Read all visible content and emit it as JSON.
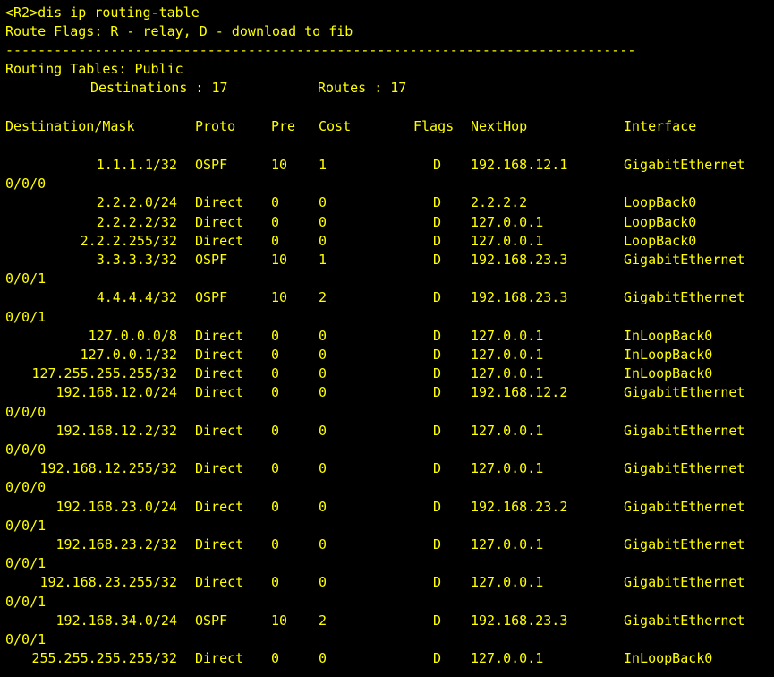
{
  "terminal": {
    "prompt_line": "<R2>dis ip routing-table",
    "flags_legend": "Route Flags: R - relay, D - download to fib",
    "separator": "------------------------------------------------------------------------------",
    "tables_title": "Routing Tables: Public",
    "destinations_label": "Destinations : 17",
    "routes_label": "Routes : 17",
    "headers": {
      "destination": "Destination/Mask",
      "proto": "Proto",
      "pre": "Pre",
      "cost": "Cost",
      "flags": "Flags",
      "nexthop": "NextHop",
      "interface": "Interface"
    },
    "routes": [
      {
        "dest": "1.1.1.1/32",
        "proto": "OSPF",
        "pre": "10",
        "cost": "1",
        "flags": "D",
        "nexthop": "192.168.12.1",
        "iface": "GigabitEthernet",
        "iface_cont": "0/0/0"
      },
      {
        "dest": "2.2.2.0/24",
        "proto": "Direct",
        "pre": "0",
        "cost": "0",
        "flags": "D",
        "nexthop": "2.2.2.2",
        "iface": "LoopBack0",
        "iface_cont": ""
      },
      {
        "dest": "2.2.2.2/32",
        "proto": "Direct",
        "pre": "0",
        "cost": "0",
        "flags": "D",
        "nexthop": "127.0.0.1",
        "iface": "LoopBack0",
        "iface_cont": ""
      },
      {
        "dest": "2.2.2.255/32",
        "proto": "Direct",
        "pre": "0",
        "cost": "0",
        "flags": "D",
        "nexthop": "127.0.0.1",
        "iface": "LoopBack0",
        "iface_cont": ""
      },
      {
        "dest": "3.3.3.3/32",
        "proto": "OSPF",
        "pre": "10",
        "cost": "1",
        "flags": "D",
        "nexthop": "192.168.23.3",
        "iface": "GigabitEthernet",
        "iface_cont": "0/0/1"
      },
      {
        "dest": "4.4.4.4/32",
        "proto": "OSPF",
        "pre": "10",
        "cost": "2",
        "flags": "D",
        "nexthop": "192.168.23.3",
        "iface": "GigabitEthernet",
        "iface_cont": "0/0/1"
      },
      {
        "dest": "127.0.0.0/8",
        "proto": "Direct",
        "pre": "0",
        "cost": "0",
        "flags": "D",
        "nexthop": "127.0.0.1",
        "iface": "InLoopBack0",
        "iface_cont": ""
      },
      {
        "dest": "127.0.0.1/32",
        "proto": "Direct",
        "pre": "0",
        "cost": "0",
        "flags": "D",
        "nexthop": "127.0.0.1",
        "iface": "InLoopBack0",
        "iface_cont": ""
      },
      {
        "dest": "127.255.255.255/32",
        "proto": "Direct",
        "pre": "0",
        "cost": "0",
        "flags": "D",
        "nexthop": "127.0.0.1",
        "iface": "InLoopBack0",
        "iface_cont": ""
      },
      {
        "dest": "192.168.12.0/24",
        "proto": "Direct",
        "pre": "0",
        "cost": "0",
        "flags": "D",
        "nexthop": "192.168.12.2",
        "iface": "GigabitEthernet",
        "iface_cont": "0/0/0"
      },
      {
        "dest": "192.168.12.2/32",
        "proto": "Direct",
        "pre": "0",
        "cost": "0",
        "flags": "D",
        "nexthop": "127.0.0.1",
        "iface": "GigabitEthernet",
        "iface_cont": "0/0/0"
      },
      {
        "dest": "192.168.12.255/32",
        "proto": "Direct",
        "pre": "0",
        "cost": "0",
        "flags": "D",
        "nexthop": "127.0.0.1",
        "iface": "GigabitEthernet",
        "iface_cont": "0/0/0"
      },
      {
        "dest": "192.168.23.0/24",
        "proto": "Direct",
        "pre": "0",
        "cost": "0",
        "flags": "D",
        "nexthop": "192.168.23.2",
        "iface": "GigabitEthernet",
        "iface_cont": "0/0/1"
      },
      {
        "dest": "192.168.23.2/32",
        "proto": "Direct",
        "pre": "0",
        "cost": "0",
        "flags": "D",
        "nexthop": "127.0.0.1",
        "iface": "GigabitEthernet",
        "iface_cont": "0/0/1"
      },
      {
        "dest": "192.168.23.255/32",
        "proto": "Direct",
        "pre": "0",
        "cost": "0",
        "flags": "D",
        "nexthop": "127.0.0.1",
        "iface": "GigabitEthernet",
        "iface_cont": "0/0/1"
      },
      {
        "dest": "192.168.34.0/24",
        "proto": "OSPF",
        "pre": "10",
        "cost": "2",
        "flags": "D",
        "nexthop": "192.168.23.3",
        "iface": "GigabitEthernet",
        "iface_cont": "0/0/1"
      },
      {
        "dest": "255.255.255.255/32",
        "proto": "Direct",
        "pre": "0",
        "cost": "0",
        "flags": "D",
        "nexthop": "127.0.0.1",
        "iface": "InLoopBack0",
        "iface_cont": ""
      }
    ]
  }
}
